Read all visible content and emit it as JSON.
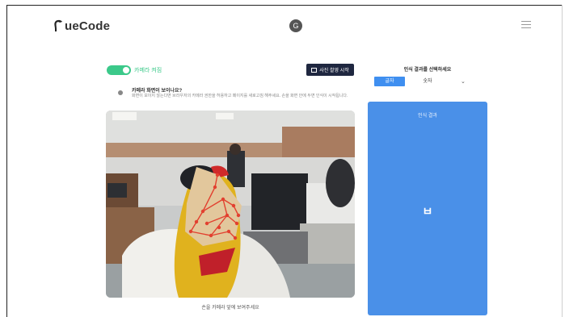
{
  "app": {
    "logo_text": "ueCode",
    "center_badge": "G"
  },
  "icons": {
    "menu": "hamburger-icon",
    "info": "info-icon",
    "logo": "logo-mark-icon",
    "button": "image-icon"
  },
  "header": {},
  "left": {
    "toggle": {
      "on": true,
      "label": "카메라 켜짐"
    },
    "action_button": {
      "label": "사진 촬영 시작"
    },
    "info": {
      "title": "카메라 화면이 보이나요?",
      "description": "화면이 보이지 않는다면 브라우저의 카메라 권한을 허용하고 페이지를 새로고침 해주세요. 손을 화면 안에 두면 인식이 시작됩니다."
    },
    "video_caption": "손을 카메라 앞에 보여주세요"
  },
  "right": {
    "title": "인식 결과를 선택하세요",
    "tabs": [
      {
        "label": "글자",
        "active": true
      },
      {
        "label": "숫자",
        "active": false
      }
    ],
    "chevron": "⌄",
    "panel": {
      "label": "인식 결과",
      "value": "ㅂ",
      "color": "#4a90e8"
    }
  },
  "colors": {
    "accent_green": "#3bc98a",
    "accent_blue": "#3f8ff0",
    "dark_button": "#1f2740"
  }
}
